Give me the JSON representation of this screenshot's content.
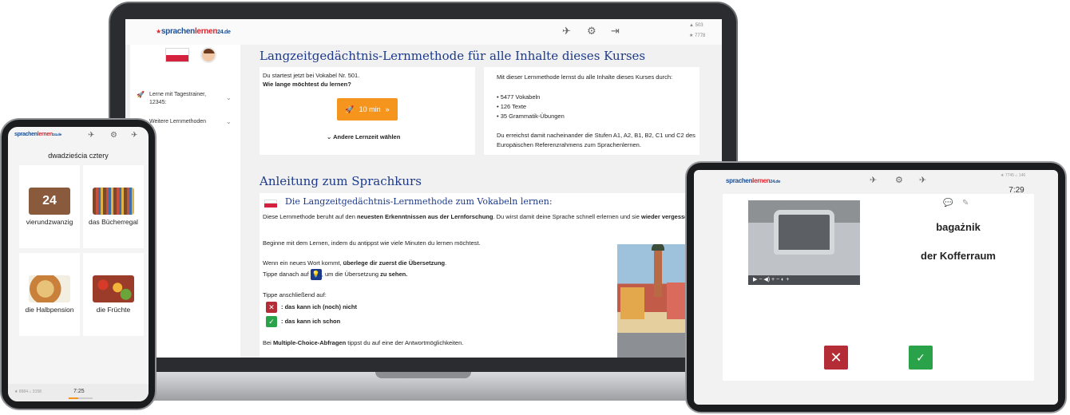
{
  "laptop": {
    "logo": {
      "part1": "sprachen",
      "part2": "lernen",
      "part3": "24.de",
      "star": "★"
    },
    "header": {
      "stat_vocab": "503",
      "stat_stars": "7778",
      "icon_a": "✈",
      "icon_b": "⚙",
      "icon_c": "⇥"
    },
    "sidebar": {
      "items": [
        {
          "icon": "🚀",
          "label": "Lerne mit Tagestrainer, 12345:",
          "chevron": "⌄"
        },
        {
          "icon": "▤",
          "label": "Weitere Lernmethoden",
          "chevron": "⌄"
        }
      ]
    },
    "main": {
      "title": "Langzeitgedächtnis-Lernmethode für alle Inhalte dieses Kurses",
      "start_text": "Du startest jetzt bei Vokabel Nr. 501.",
      "question": "Wie lange möchtest du lernen?",
      "start_button": "10 min",
      "start_button_icon": "🚀",
      "start_button_arrow": "»",
      "other_time": "Andere Lernzeit wählen",
      "other_time_chevron": "⌄",
      "info_intro": "Mit dieser Lernmethode lernst du alle Inhalte dieses Kurses durch:",
      "info_items": [
        "5477 Vokabeln",
        "126 Texte",
        "35 Grammatik-Übungen"
      ],
      "info_outro": "Du erreichst damit nacheinander die Stufen A1, A2, B1, B2, C1 und C2 des Europäischen Referenzrahmens zum Sprachenlernen.",
      "guide_title": "Anleitung zum Sprachkurs",
      "guide_subtitle": "Die Langzeitgedächtnis-Lernmethode zum Vokabeln lernen:",
      "p1_a": "Diese Lernmethode beruht auf den ",
      "p1_b": "neuesten Erkenntnissen aus der Lernforschung",
      "p1_c": ". Du wirst damit deine Sprache schnell erlernen und sie ",
      "p1_d": "wieder vergessen",
      "p1_e": ".",
      "p2": "Beginne mit dem Lernen, indem du antippst wie viele Minuten du lernen möchtest.",
      "p3_a": "Wenn ein neues Wort kommt, ",
      "p3_b": "überlege dir zuerst die Übersetzung",
      "p3_c": ".",
      "p4_a": "Tippe danach auf",
      "p4_b": ", um die Übersetzung ",
      "p4_c": "zu sehen.",
      "bulb": "💡",
      "p5": "Tippe anschließend auf:",
      "x_mark": "✕",
      "check_mark": "✓",
      "dont_know": ": das kann ich (noch) nicht",
      "know": ": das kann ich schon",
      "p6_a": "Bei ",
      "p6_b": "Multiple-Choice-Abfragen",
      "p6_c": " tippst du auf eine der Antwortmöglichkeiten."
    }
  },
  "phone": {
    "logo": {
      "part1": "sprachen",
      "part2": "lernen",
      "part3": "24.de"
    },
    "icons": {
      "a": "✈",
      "b": "⚙",
      "c": "✈"
    },
    "title": "dwadzieścia cztery",
    "tiles": [
      {
        "label": "vierundzwanzig",
        "img_text": "24",
        "color": "#8a5a3c"
      },
      {
        "label": "das Bücherregal",
        "img_text": "",
        "color": "#7a4a2a"
      },
      {
        "label": "die Halbpension",
        "img_text": "",
        "color": "#d9a35b"
      },
      {
        "label": "die Früchte",
        "img_text": "",
        "color": "#9b3b2a"
      }
    ],
    "footer": {
      "left_stats": "★ 8984  ⌂ 3158",
      "time": "7:25"
    }
  },
  "tablet": {
    "logo": {
      "part1": "sprachen",
      "part2": "lernen",
      "part3": "24.de"
    },
    "icons": {
      "a": "✈",
      "b": "⚙",
      "c": "✈"
    },
    "stats": "★ 7745  ⌂ 146",
    "time": "7:29",
    "media_controls": "▶  − ◀) +   − ◐ +",
    "comment_icon": "💬",
    "edit_icon": "✎",
    "word_pl": "bagażnik",
    "word_de": "der Kofferraum",
    "x_mark": "✕",
    "ok_mark": "✓"
  }
}
